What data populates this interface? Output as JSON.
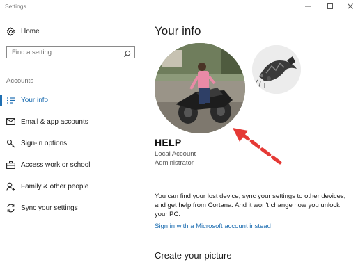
{
  "window": {
    "title": "Settings"
  },
  "sidebar": {
    "home_label": "Home",
    "search": {
      "placeholder": "Find a setting"
    },
    "section_label": "Accounts",
    "items": [
      {
        "label": "Your info",
        "icon": "person-card-icon",
        "active": true
      },
      {
        "label": "Email & app accounts",
        "icon": "mail-icon"
      },
      {
        "label": "Sign-in options",
        "icon": "key-icon"
      },
      {
        "label": "Access work or school",
        "icon": "briefcase-icon"
      },
      {
        "label": "Family & other people",
        "icon": "person-add-icon"
      },
      {
        "label": "Sync your settings",
        "icon": "sync-icon"
      }
    ]
  },
  "main": {
    "title": "Your info",
    "user_name": "HELP",
    "account_type": "Local Account",
    "account_role": "Administrator",
    "info_text": "You can find your lost device, sync your settings to other devices, and get help from Cortana. And it won't change how you unlock your PC.",
    "microsoft_link": "Sign in with a Microsoft account instead",
    "create_picture_title": "Create your picture"
  },
  "colors": {
    "accent": "#1f6fb2",
    "arrow": "#e53935"
  }
}
